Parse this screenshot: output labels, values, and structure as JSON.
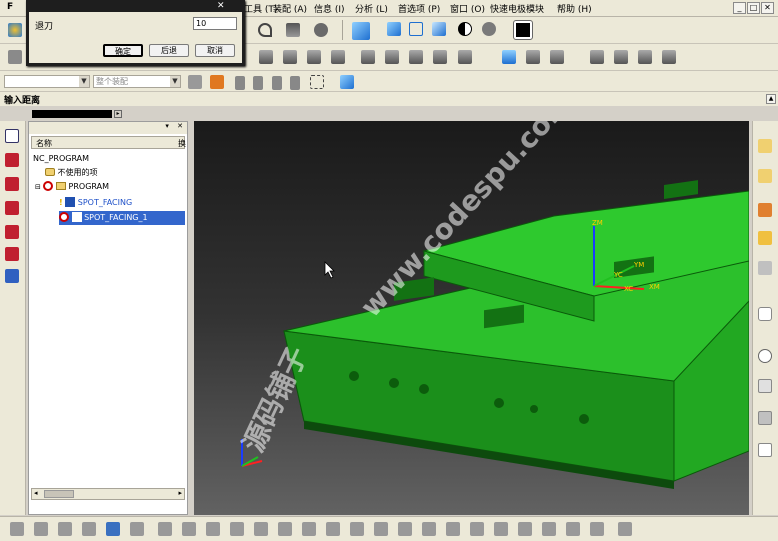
{
  "menubar": {
    "items": [
      "工具 (T)",
      "装配 (A)",
      "信息 (I)",
      "分析 (L)",
      "首选项 (P)",
      "窗口 (O)",
      "快速电极模块",
      "帮助 (H)"
    ],
    "window_buttons": [
      "_",
      "□",
      "✕"
    ]
  },
  "combos": {
    "combo1": "",
    "combo2": "整个装配"
  },
  "cue_line": "输入距离",
  "dialog": {
    "label": "退刀",
    "value": "10",
    "ok": "确定",
    "back": "后退",
    "cancel": "取消"
  },
  "navigator": {
    "col_name": "名称",
    "col_extra": "换",
    "rows": [
      {
        "text": "NC_PROGRAM",
        "indent": 0
      },
      {
        "text": "不使用的项",
        "indent": 1
      },
      {
        "text": "PROGRAM",
        "indent": 1
      },
      {
        "text": "SPOT_FACING",
        "indent": 2
      },
      {
        "text": "SPOT_FACING_1",
        "indent": 2
      }
    ]
  },
  "model": {
    "csys_labels": [
      "ZM",
      "YM",
      "XM",
      "XC",
      "YC"
    ]
  },
  "watermark": "www.codespu.com",
  "watermark2": "源码铺子",
  "colors": {
    "part_green": "#22a822",
    "selection_blue": "#3366cc",
    "program_red": "#cc0000",
    "tool_blue": "#1e6fd0",
    "toolbar_bg": "#ece9d8"
  }
}
